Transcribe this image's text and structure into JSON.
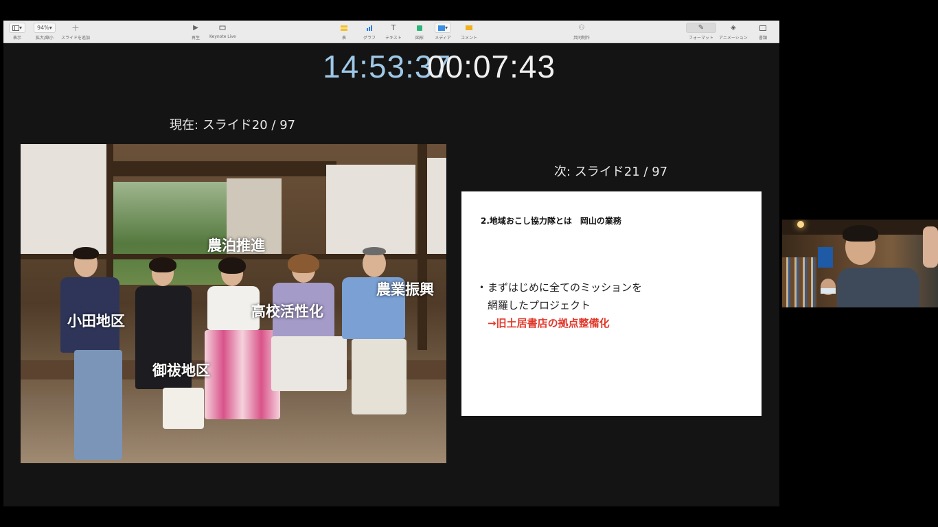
{
  "toolbar": {
    "view_label": "表示",
    "zoom_value": "94%",
    "zoom_label": "拡大/縮小",
    "add_slide_label": "スライドを追加",
    "play_label": "再生",
    "keynote_live_label": "Keynote Live",
    "table_label": "表",
    "chart_label": "グラフ",
    "text_label": "テキスト",
    "shape_label": "図形",
    "media_label": "メディア",
    "comment_label": "コメント",
    "collaborate_label": "共同制作",
    "format_label": "フォーマット",
    "animate_label": "アニメーション",
    "document_label": "書類"
  },
  "presenter": {
    "clock": "14:53:37",
    "timer": "00:07:43",
    "current_label": "現在: スライド20 / 97",
    "next_label": "次: スライド21 / 97"
  },
  "current_slide": {
    "labels": [
      "農泊推進",
      "農業振興",
      "高校活性化",
      "小田地区",
      "御祓地区"
    ]
  },
  "next_slide": {
    "title": "2.地域おこし協力隊とは　岡山の業務",
    "bullet_line1": "まずはじめに全てのミッションを",
    "bullet_line2": "網羅したプロジェクト",
    "bullet_line3": "→旧土居書店の拠点整備化"
  },
  "colors": {
    "clock": "#9ec8e6",
    "timer": "#f0f0f0",
    "accent_red": "#e0392b",
    "toolbar_bg": "#ebebeb",
    "presenter_bg": "#141414"
  },
  "icons": [
    "view-icon",
    "zoom-icon",
    "add-slide-icon",
    "play-icon",
    "keynote-live-icon",
    "table-icon",
    "chart-icon",
    "text-icon",
    "shape-icon",
    "media-icon",
    "comment-icon",
    "collaborate-icon",
    "format-icon",
    "animate-icon",
    "document-icon"
  ]
}
